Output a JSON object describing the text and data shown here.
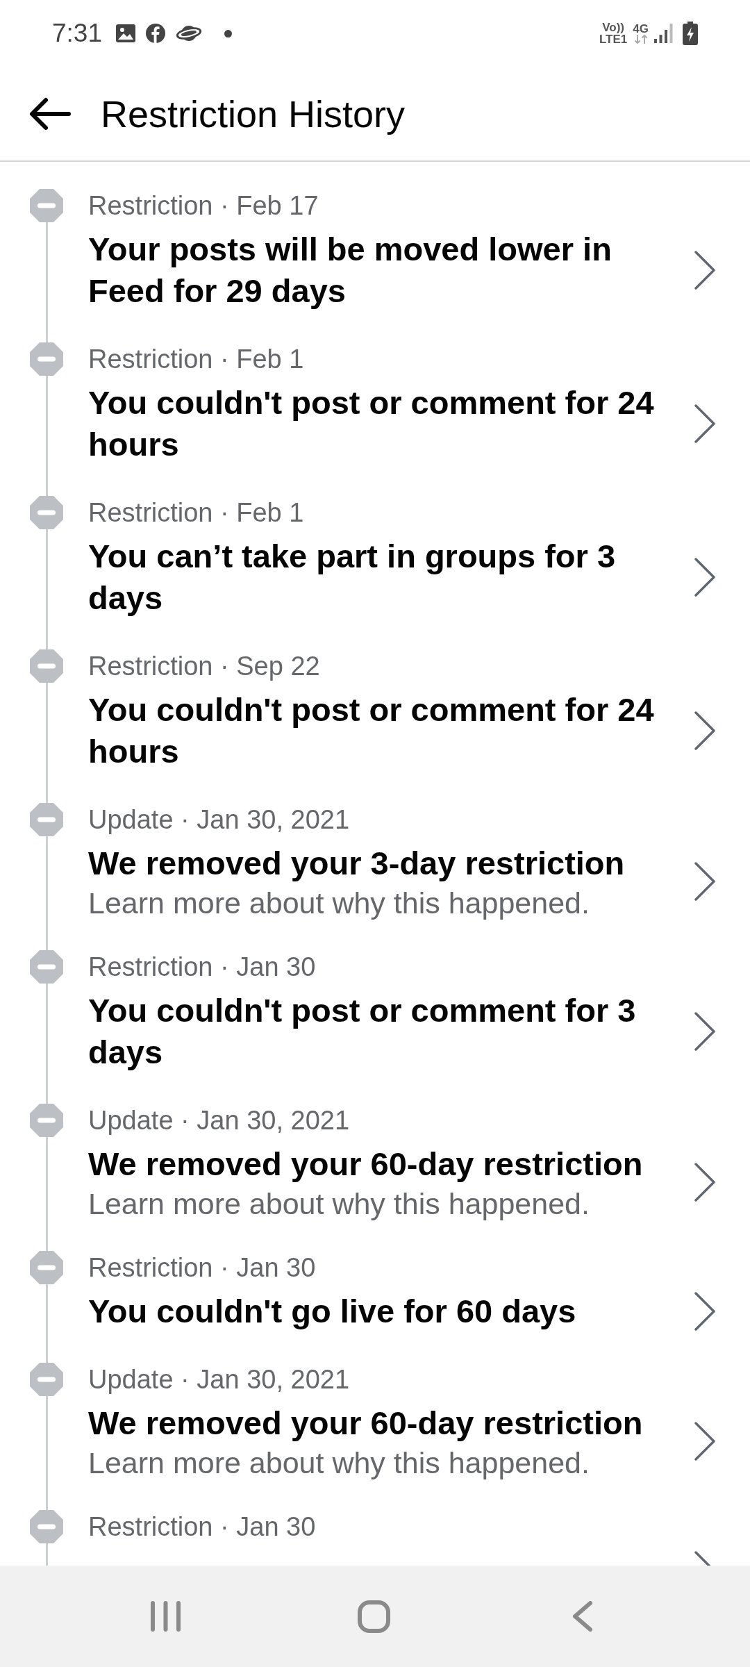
{
  "status_bar": {
    "time": "7:31",
    "volte_top": "Vo))",
    "volte_bottom": "LTE1",
    "network": "4G"
  },
  "header": {
    "title": "Restriction History"
  },
  "history": [
    {
      "meta": "Restriction · Feb 17",
      "title": "Your posts will be moved lower in Feed for 29 days"
    },
    {
      "meta": "Restriction · Feb 1",
      "title": "You couldn't post or comment for 24 hours"
    },
    {
      "meta": "Restriction · Feb 1",
      "title": "You can’t take part in groups for 3 days"
    },
    {
      "meta": "Restriction · Sep 22",
      "title": "You couldn't post or comment for 24 hours"
    },
    {
      "meta": "Update · Jan 30, 2021",
      "title": "We removed your 3-day restriction",
      "note": "Learn more about why this happened."
    },
    {
      "meta": "Restriction · Jan 30",
      "title": "You couldn't post or comment for 3 days"
    },
    {
      "meta": "Update · Jan 30, 2021",
      "title": "We removed your 60-day restriction",
      "note": "Learn more about why this happened."
    },
    {
      "meta": "Restriction · Jan 30",
      "title": "You couldn't go live for 60 days"
    },
    {
      "meta": "Update · Jan 30, 2021",
      "title": "We removed your 60-day restriction",
      "note": "Learn more about why this happened."
    },
    {
      "meta": "Restriction · Jan 30"
    }
  ]
}
